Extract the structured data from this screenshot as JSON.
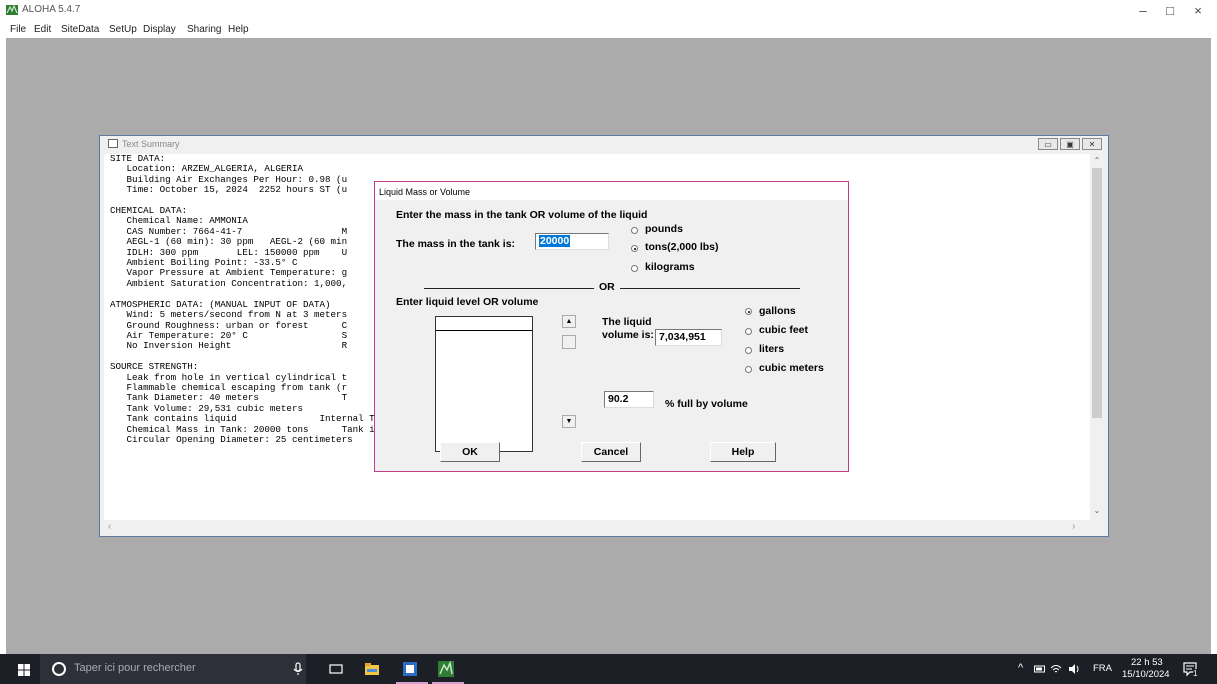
{
  "app": {
    "title": "ALOHA 5.4.7",
    "controls": {
      "minimize": "–",
      "maximize": "□",
      "close": "×"
    }
  },
  "menu": [
    "File",
    "Edit",
    "SiteData",
    "SetUp",
    "Display",
    "Sharing",
    "Help"
  ],
  "text_summary": {
    "title": "Text Summary",
    "lines": [
      "SITE DATA:",
      "   Location: ARZEW_ALGERIA, ALGERIA",
      "   Building Air Exchanges Per Hour: 0.98 (u",
      "   Time: October 15, 2024  2252 hours ST (u",
      "",
      "CHEMICAL DATA:",
      "   Chemical Name: AMMONIA",
      "   CAS Number: 7664-41-7                  M",
      "   AEGL-1 (60 min): 30 ppm   AEGL-2 (60 min",
      "   IDLH: 300 ppm       LEL: 150000 ppm    U",
      "   Ambient Boiling Point: -33.5° C",
      "   Vapor Pressure at Ambient Temperature: g",
      "   Ambient Saturation Concentration: 1,000,",
      "",
      "ATMOSPHERIC DATA: (MANUAL INPUT OF DATA)",
      "   Wind: 5 meters/second from N at 3 meters",
      "   Ground Roughness: urban or forest      C",
      "   Air Temperature: 20° C                 S",
      "   No Inversion Height                    R",
      "",
      "SOURCE STRENGTH:",
      "   Leak from hole in vertical cylindrical t",
      "   Flammable chemical escaping from tank (r",
      "   Tank Diameter: 40 meters               T",
      "   Tank Volume: 29,531 cubic meters",
      "   Tank contains liquid               Internal Temperature: -33° C",
      "   Chemical Mass in Tank: 20000 tons      Tank is 90% full",
      "   Circular Opening Diameter: 25 centimeters"
    ]
  },
  "dialog": {
    "title": "Liquid Mass or Volume",
    "heading": "Enter the mass in the tank OR volume of the liquid",
    "mass_label": "The mass in the tank is:",
    "mass_value": "20000",
    "mass_units": [
      {
        "label": "pounds",
        "selected": false
      },
      {
        "label": "tons(2,000 lbs)",
        "selected": true
      },
      {
        "label": "kilograms",
        "selected": false
      }
    ],
    "or_label": "OR",
    "level_heading": "Enter liquid level OR volume",
    "volume_label_1": "The liquid",
    "volume_label_2": "volume is:",
    "volume_value": "7,034,951",
    "volume_units": [
      {
        "label": "gallons",
        "selected": true
      },
      {
        "label": "cubic feet",
        "selected": false
      },
      {
        "label": "liters",
        "selected": false
      },
      {
        "label": "cubic meters",
        "selected": false
      }
    ],
    "percent_value": "90.2",
    "percent_label": "% full by volume",
    "fill_fraction": 0.902,
    "buttons": {
      "ok": "OK",
      "cancel": "Cancel",
      "help": "Help"
    }
  },
  "taskbar": {
    "search_placeholder": "Taper ici pour rechercher",
    "language": "FRA",
    "time": "22 h 53",
    "date": "15/10/2024",
    "notification_count": "1"
  }
}
